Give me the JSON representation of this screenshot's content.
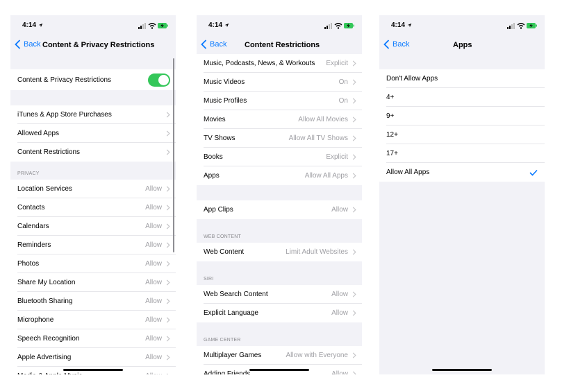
{
  "status": {
    "time": "4:14"
  },
  "screen1": {
    "back": "Back",
    "title": "Content & Privacy Restrictions",
    "toggle_row": "Content & Privacy Restrictions",
    "group1": [
      {
        "label": "iTunes & App Store Purchases"
      },
      {
        "label": "Allowed Apps"
      },
      {
        "label": "Content Restrictions"
      }
    ],
    "privacy_header": "PRIVACY",
    "privacy": [
      {
        "label": "Location Services",
        "value": "Allow"
      },
      {
        "label": "Contacts",
        "value": "Allow"
      },
      {
        "label": "Calendars",
        "value": "Allow"
      },
      {
        "label": "Reminders",
        "value": "Allow"
      },
      {
        "label": "Photos",
        "value": "Allow"
      },
      {
        "label": "Share My Location",
        "value": "Allow"
      },
      {
        "label": "Bluetooth Sharing",
        "value": "Allow"
      },
      {
        "label": "Microphone",
        "value": "Allow"
      },
      {
        "label": "Speech Recognition",
        "value": "Allow"
      },
      {
        "label": "Apple Advertising",
        "value": "Allow"
      },
      {
        "label": "Media & Apple Music",
        "value": "Allow"
      }
    ]
  },
  "screen2": {
    "back": "Back",
    "title": "Content Restrictions",
    "group1": [
      {
        "label": "Music, Podcasts, News, & Workouts",
        "value": "Explicit"
      },
      {
        "label": "Music Videos",
        "value": "On"
      },
      {
        "label": "Music Profiles",
        "value": "On"
      },
      {
        "label": "Movies",
        "value": "Allow All Movies"
      },
      {
        "label": "TV Shows",
        "value": "Allow All TV Shows"
      },
      {
        "label": "Books",
        "value": "Explicit"
      },
      {
        "label": "Apps",
        "value": "Allow All Apps"
      }
    ],
    "app_clips": {
      "label": "App Clips",
      "value": "Allow"
    },
    "web_header": "WEB CONTENT",
    "web": [
      {
        "label": "Web Content",
        "value": "Limit Adult Websites"
      }
    ],
    "siri_header": "SIRI",
    "siri": [
      {
        "label": "Web Search Content",
        "value": "Allow"
      },
      {
        "label": "Explicit Language",
        "value": "Allow"
      }
    ],
    "game_header": "GAME CENTER",
    "game": [
      {
        "label": "Multiplayer Games",
        "value": "Allow with Everyone"
      },
      {
        "label": "Adding Friends",
        "value": "Allow"
      }
    ]
  },
  "screen3": {
    "back": "Back",
    "title": "Apps",
    "options": [
      {
        "label": "Don't Allow Apps"
      },
      {
        "label": "4+"
      },
      {
        "label": "9+"
      },
      {
        "label": "12+"
      },
      {
        "label": "17+"
      },
      {
        "label": "Allow All Apps"
      }
    ],
    "selected_index": 5
  },
  "colors": {
    "accent": "#0a7aff",
    "toggle_on": "#34c759",
    "background": "#f2f2f7"
  },
  "icons": [
    "back-chevron-icon",
    "row-chevron-icon",
    "checkmark-icon",
    "signal-icon",
    "wifi-icon",
    "battery-charging-icon",
    "location-arrow-icon"
  ]
}
